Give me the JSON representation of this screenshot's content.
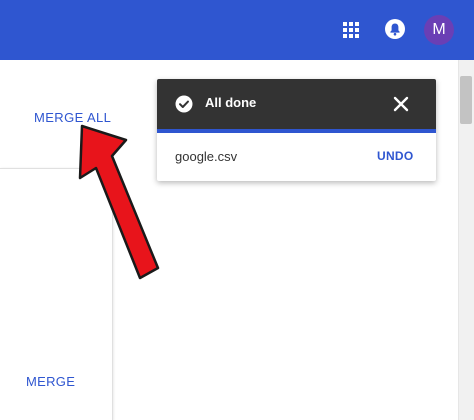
{
  "topbar": {
    "bg_color": "#2f56d0",
    "apps_icon": "apps-grid-icon",
    "notifications_icon": "bell-icon",
    "avatar_letter": "M",
    "avatar_color": "#6a3fb5"
  },
  "main": {
    "merge_all_label": "MERGE ALL",
    "merge_label": "MERGE"
  },
  "toast": {
    "title": "All done",
    "filename": "google.csv",
    "undo_label": "UNDO",
    "check_icon": "check-circle-icon",
    "close_icon": "close-icon",
    "header_color": "#333333",
    "accent_color": "#2f56d0"
  },
  "annotation": {
    "arrow_color": "#e8141b",
    "arrow_icon": "red-arrow-annotation"
  }
}
